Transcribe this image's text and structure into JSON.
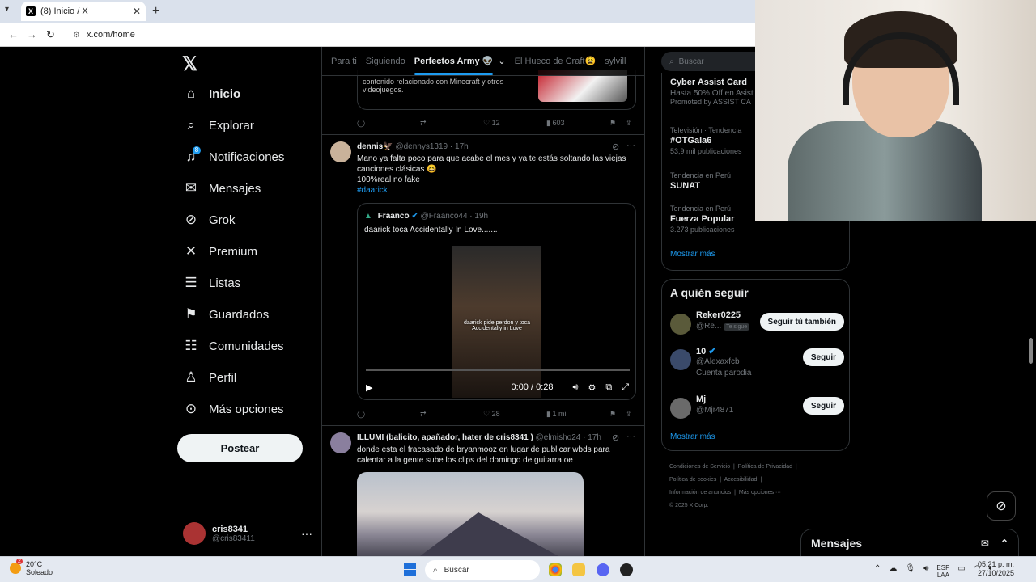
{
  "browser": {
    "tab_title": "(8) Inicio / X",
    "url": "x.com/home"
  },
  "nav": {
    "items": [
      {
        "label": "Inicio",
        "icon": "home-icon"
      },
      {
        "label": "Explorar",
        "icon": "search-icon"
      },
      {
        "label": "Notificaciones",
        "icon": "bell-icon",
        "badge": "8"
      },
      {
        "label": "Mensajes",
        "icon": "mail-icon"
      },
      {
        "label": "Grok",
        "icon": "grok-icon"
      },
      {
        "label": "Premium",
        "icon": "x-icon"
      },
      {
        "label": "Listas",
        "icon": "list-icon"
      },
      {
        "label": "Guardados",
        "icon": "bookmark-icon"
      },
      {
        "label": "Comunidades",
        "icon": "people-icon"
      },
      {
        "label": "Perfil",
        "icon": "person-icon"
      },
      {
        "label": "Más opciones",
        "icon": "more-circle-icon"
      }
    ],
    "post_button": "Postear",
    "account": {
      "name": "cris8341",
      "handle": "@cris83411"
    }
  },
  "feed": {
    "tabs": [
      "Para ti",
      "Siguiendo",
      "Perfectos Army 👽",
      "El Hueco de Craft😩",
      "sylvill"
    ],
    "card1": {
      "text": "contenido relacionado con Minecraft y otros videojuegos."
    },
    "post1_stats": {
      "likes": "12",
      "views": "603"
    },
    "post2": {
      "name": "dennis🦅",
      "handle": "@dennys1319",
      "time": "17h",
      "line1": "Mano ya falta poco para que acabe el mes y ya te estás soltando las viejas canciones clásicas 😆",
      "line2": "100%real no fake",
      "hashtag": "#daarick",
      "quote": {
        "name": "Fraanco",
        "handle": "@Fraanco44",
        "time": "19h",
        "text": "daarick toca Accidentally In Love.......",
        "video_caption": "daarick pide perdon y toca Accidentally in Love",
        "time_display": "0:00 / 0:28"
      },
      "likes": "28",
      "views": "1 mil"
    },
    "post3": {
      "name": "ILLUMI (balicito, apañador, hater de cris8341 )",
      "handle": "@elmisho24",
      "time": "17h",
      "text": "donde esta el fracasado de bryanmooz  en lugar de  publicar wbds para calentar a la gente sube  los clips del domingo de guitarra  oe"
    }
  },
  "right": {
    "search_placeholder": "Buscar",
    "trends": [
      {
        "title": "Cyber Assist Card",
        "sub": "Hasta 50% Off en Asist",
        "meta": "Promoted by ASSIST CA"
      },
      {
        "context": "Televisión · Tendencia",
        "title": "#OTGala6",
        "meta": "53,9 mil publicaciones"
      },
      {
        "context": "Tendencia en Perú",
        "title": "SUNAT"
      },
      {
        "context": "Tendencia en Perú",
        "title": "Fuerza Popular",
        "meta": "3.273 publicaciones"
      }
    ],
    "show_more": "Mostrar más",
    "follow_title": "A quién seguir",
    "follow": [
      {
        "name": "Reker0225",
        "handle": "@Re...",
        "note": "Te sigue",
        "button": "Seguir tú también"
      },
      {
        "name": "10",
        "handle": "@Alexaxfcb",
        "note": "Cuenta parodia",
        "button": "Seguir"
      },
      {
        "name": "Mj",
        "handle": "@Mjr4871",
        "button": "Seguir"
      }
    ],
    "footer": [
      "Condiciones de Servicio",
      "Política de Privacidad",
      "Política de cookies",
      "Accesibilidad",
      "Información de anuncios",
      "Más opciones ···",
      "© 2025 X Corp."
    ],
    "messages": "Mensajes"
  },
  "taskbar": {
    "temp": "20°C",
    "weather": "Soleado",
    "weather_badge": "2",
    "search": "Buscar",
    "lang1": "ESP",
    "lang2": "LAA",
    "time": "05:21 p. m.",
    "date": "27/10/2025"
  }
}
